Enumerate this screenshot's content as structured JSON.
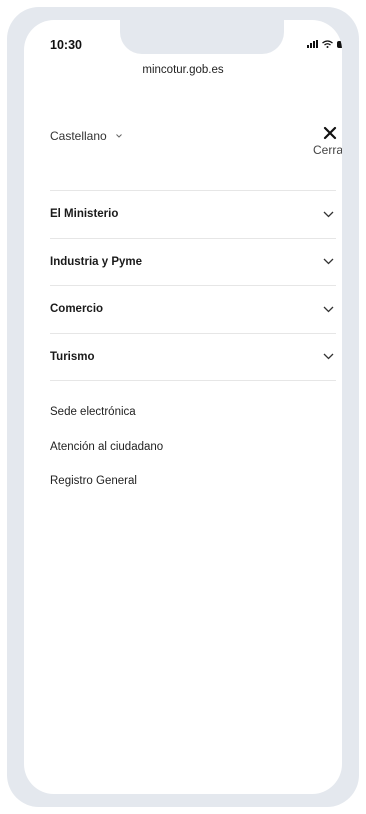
{
  "status_bar": {
    "time": "10:30"
  },
  "browser": {
    "url": "mincotur.gob.es"
  },
  "header": {
    "language": "Castellano",
    "close_label": "Cerrar"
  },
  "menu": {
    "items": [
      {
        "label": "El Ministerio"
      },
      {
        "label": "Industria y Pyme"
      },
      {
        "label": "Comercio"
      },
      {
        "label": "Turismo"
      }
    ]
  },
  "links": [
    {
      "label": "Sede electrónica"
    },
    {
      "label": "Atención al ciudadano"
    },
    {
      "label": "Registro General"
    }
  ]
}
